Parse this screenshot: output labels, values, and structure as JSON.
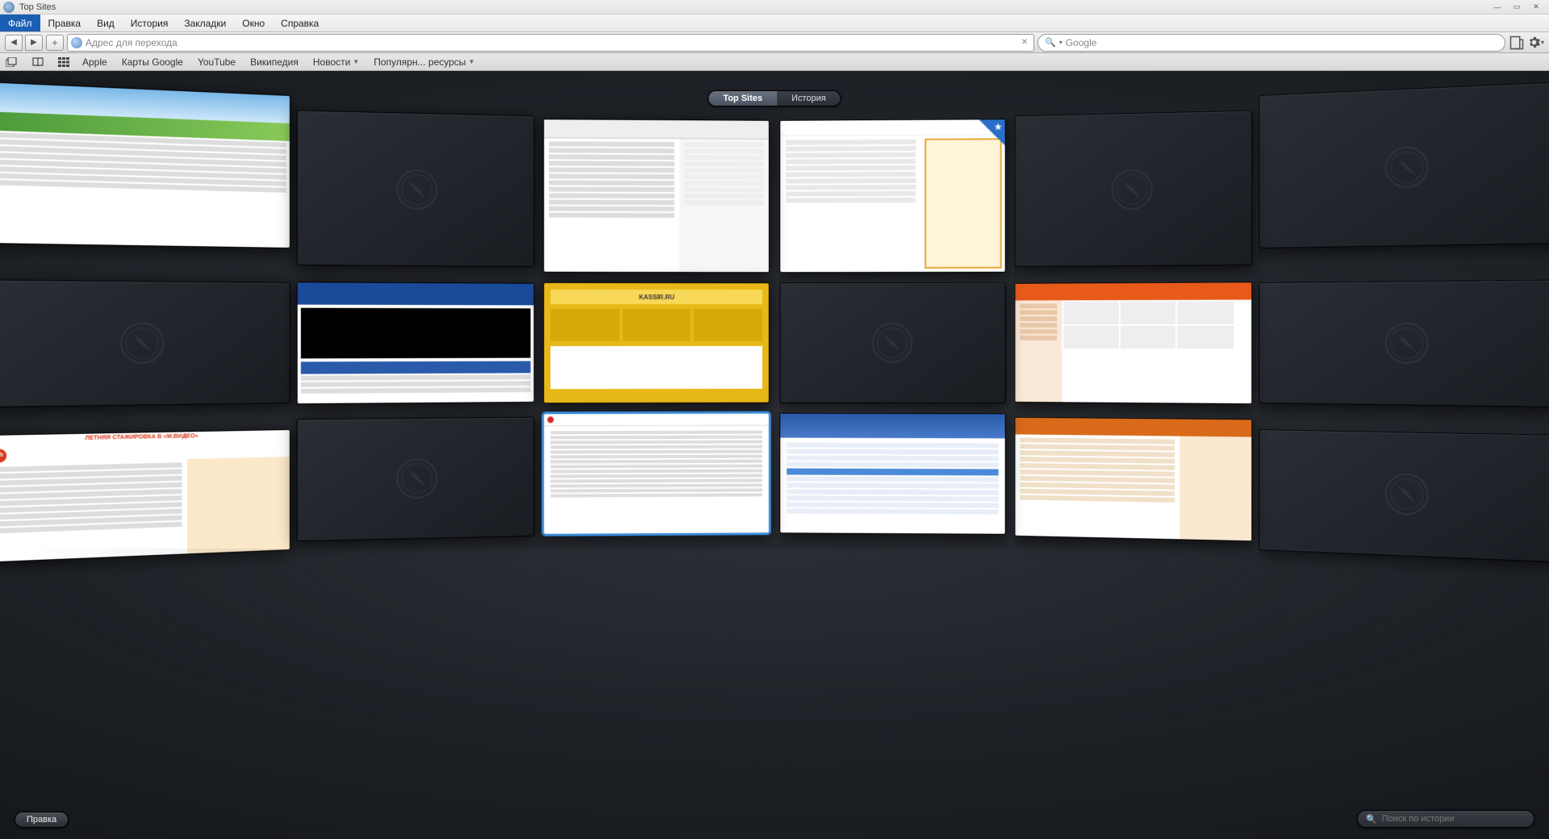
{
  "titlebar": {
    "title": "Top Sites"
  },
  "menu": {
    "items": [
      "Файл",
      "Правка",
      "Вид",
      "История",
      "Закладки",
      "Окно",
      "Справка"
    ],
    "active_index": 0
  },
  "toolbar": {
    "address_placeholder": "Адрес для перехода",
    "search_placeholder": "Google"
  },
  "bookmarks": {
    "items": [
      {
        "label": "Apple",
        "dropdown": false
      },
      {
        "label": "Карты Google",
        "dropdown": false
      },
      {
        "label": "YouTube",
        "dropdown": false
      },
      {
        "label": "Википедия",
        "dropdown": false
      },
      {
        "label": "Новости",
        "dropdown": true
      },
      {
        "label": "Популярн... ресурсы",
        "dropdown": true
      }
    ]
  },
  "segmented": {
    "top_sites": "Top Sites",
    "history": "История",
    "active": "top_sites"
  },
  "bottom": {
    "edit_label": "Правка",
    "history_search_placeholder": "Поиск по истории"
  },
  "tiles": [
    [
      {
        "empty": false,
        "pinned": false,
        "selected": false,
        "theme": "blue-sky"
      },
      {
        "empty": true
      },
      {
        "empty": false,
        "pinned": false,
        "selected": false,
        "theme": "news-gray"
      },
      {
        "empty": false,
        "pinned": true,
        "selected": false,
        "theme": "yandex"
      },
      {
        "empty": true
      },
      {
        "empty": true
      }
    ],
    [
      {
        "empty": true
      },
      {
        "empty": false,
        "pinned": false,
        "selected": false,
        "theme": "tv-blue"
      },
      {
        "empty": false,
        "pinned": false,
        "selected": false,
        "theme": "yellow"
      },
      {
        "empty": true
      },
      {
        "empty": false,
        "pinned": false,
        "selected": false,
        "theme": "orange-shop"
      },
      {
        "empty": true
      }
    ],
    [
      {
        "empty": false,
        "pinned": false,
        "selected": false,
        "theme": "hh"
      },
      {
        "empty": true
      },
      {
        "empty": false,
        "pinned": false,
        "selected": true,
        "theme": "table-white"
      },
      {
        "empty": false,
        "pinned": false,
        "selected": false,
        "theme": "portal-blue"
      },
      {
        "empty": false,
        "pinned": false,
        "selected": false,
        "theme": "forum-orange"
      },
      {
        "empty": true
      }
    ]
  ]
}
